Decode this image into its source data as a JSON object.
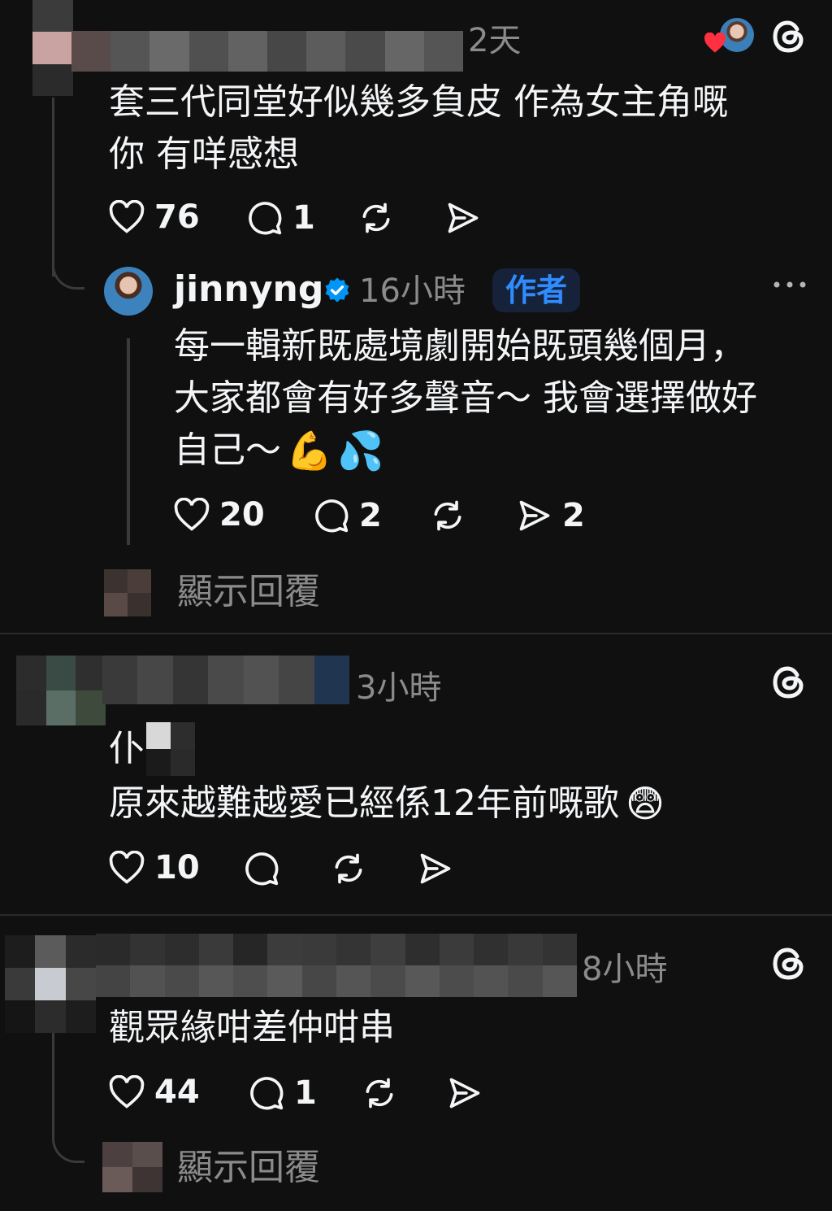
{
  "comment1": {
    "time": "2天",
    "text_line1": "套三代同堂好似幾多負皮 作為女主角嘅",
    "text_line2": "你 有咩感想",
    "likes": "76",
    "replies": "1"
  },
  "reply1": {
    "username": "jinnyng",
    "time": "16小時",
    "author_badge": "作者",
    "text_line1": "每一輯新既處境劇開始既頭幾個月，",
    "text_line2": "大家都會有好多聲音～ 我會選擇做好",
    "text_line3": "自己～",
    "emoji1": "💪",
    "emoji2": "💦",
    "likes": "20",
    "replies": "2",
    "shares": "2"
  },
  "show_replies_1": "顯示回覆",
  "comment2": {
    "time": "3小時",
    "text_line1": "仆",
    "text_line2": "原來越難越愛已經係12年前嘅歌",
    "emoji": "😨",
    "likes": "10"
  },
  "comment3": {
    "time": "8小時",
    "text_line1": "觀眾緣咁差仲咁串",
    "likes": "44",
    "replies": "1"
  },
  "show_replies_2": "顯示回覆",
  "colors": {
    "background": "#101010",
    "text": "#f3f5f7",
    "secondary": "#8b8b8b",
    "verified": "#0095f6",
    "heart": "#ff3040"
  }
}
